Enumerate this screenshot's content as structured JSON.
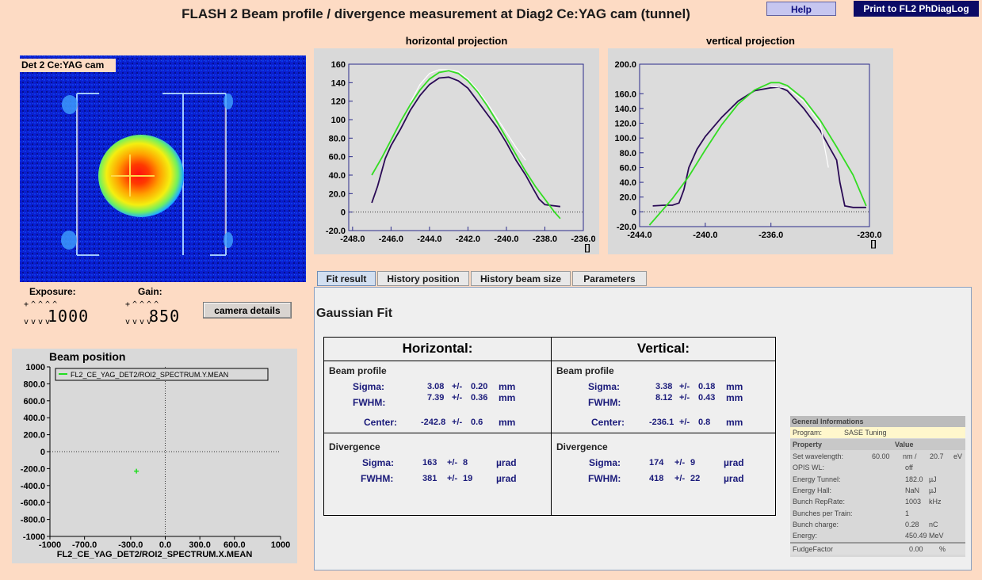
{
  "title": "FLASH 2  Beam profile / divergence measurement at Diag2 Ce:YAG cam (tunnel)",
  "buttons": {
    "help": "Help",
    "print": "Print to FL2  PhDiagLog",
    "camera_details": "camera details"
  },
  "camera": {
    "label": "Det 2 Ce:YAG cam"
  },
  "controls": {
    "exposure_label": "Exposure:",
    "exposure_value": "1000",
    "gain_label": "Gain:",
    "gain_value": "850",
    "spin_up": "+^^^^",
    "spin_down": "vvvv"
  },
  "horizontal_projection": {
    "title": "horizontal projection",
    "chart_data": {
      "type": "line",
      "x_ticks": [
        "-248.0",
        "-246.0",
        "-244.0",
        "-242.0",
        "-240.0",
        "-238.0",
        "-236.0"
      ],
      "y_ticks": [
        "160",
        "140",
        "120",
        "100",
        "80.0",
        "60.0",
        "40.0",
        "20.0",
        "0",
        "-20.0"
      ],
      "xlim": [
        -248.2,
        -236.0
      ],
      "ylim": [
        -20,
        160
      ],
      "unit_label": "[]",
      "series": [
        {
          "color": "#2a0a55",
          "x": [
            -247.0,
            -246.7,
            -246.3,
            -246.0,
            -245.5,
            -245.0,
            -244.5,
            -244.0,
            -243.5,
            -243.0,
            -242.5,
            -242.0,
            -241.5,
            -241.0,
            -240.5,
            -240.0,
            -239.5,
            -239.0,
            -238.6,
            -238.3,
            -238.0,
            -237.6,
            -237.2
          ],
          "y": [
            10,
            28,
            58,
            72,
            90,
            110,
            126,
            138,
            145,
            146,
            142,
            134,
            120,
            106,
            92,
            75,
            56,
            40,
            25,
            14,
            8,
            7,
            6
          ]
        },
        {
          "color": "#ffffff",
          "x": [
            -245.0,
            -244.5,
            -244.0,
            -243.5,
            -243.0,
            -242.5,
            -242.0,
            -241.5,
            -241.0,
            -240.5,
            -240.0,
            -239.5,
            -239.0
          ],
          "y": [
            118,
            138,
            150,
            154,
            154,
            152,
            144,
            132,
            118,
            102,
            86,
            70,
            56
          ]
        },
        {
          "color": "#33dd22",
          "x": [
            -247.0,
            -246.5,
            -246.0,
            -245.5,
            -245.0,
            -244.5,
            -244.0,
            -243.5,
            -243.0,
            -242.5,
            -242.0,
            -241.5,
            -241.0,
            -240.5,
            -240.0,
            -239.5,
            -239.0,
            -238.5,
            -238.0,
            -237.5,
            -237.2
          ],
          "y": [
            40,
            58,
            78,
            98,
            116,
            132,
            144,
            151,
            153,
            150,
            142,
            130,
            115,
            98,
            80,
            62,
            44,
            28,
            14,
            0,
            -7
          ]
        }
      ]
    }
  },
  "vertical_projection": {
    "title": "vertical projection",
    "chart_data": {
      "type": "line",
      "x_ticks": [
        "-244.0",
        "-240.0",
        "-236.0",
        "-230.0"
      ],
      "y_ticks": [
        "200.0",
        "160.0",
        "140.0",
        "120.0",
        "100.0",
        "80.0",
        "60.0",
        "40.0",
        "20.0",
        "0",
        "-20.0"
      ],
      "xlim": [
        -244.0,
        -230.0
      ],
      "ylim": [
        -20,
        200
      ],
      "unit_label": "[]",
      "series": [
        {
          "color": "#2a0a55",
          "x": [
            -243.2,
            -242.5,
            -242.0,
            -241.6,
            -241.3,
            -241.0,
            -240.5,
            -240.0,
            -239.0,
            -238.0,
            -237.0,
            -236.0,
            -235.5,
            -235.0,
            -234.5,
            -234.0,
            -233.0,
            -232.5,
            -232.0,
            -231.8,
            -231.5,
            -231.0,
            -230.2
          ],
          "y": [
            8,
            9,
            9,
            12,
            30,
            60,
            85,
            102,
            128,
            150,
            164,
            168,
            169,
            164,
            152,
            140,
            110,
            90,
            70,
            40,
            8,
            6,
            6
          ]
        },
        {
          "color": "#ffffff",
          "x": [
            -236.0,
            -235.0,
            -234.0,
            -233.0,
            -232.5
          ],
          "y": [
            170,
            168,
            150,
            120,
            60
          ]
        },
        {
          "color": "#33dd22",
          "x": [
            -243.4,
            -242.5,
            -242.0,
            -241.0,
            -240.0,
            -239.0,
            -238.0,
            -237.0,
            -236.0,
            -235.5,
            -235.0,
            -234.0,
            -233.0,
            -232.0,
            -231.0,
            -230.2
          ],
          "y": [
            -18,
            5,
            18,
            48,
            84,
            118,
            146,
            165,
            175,
            175,
            171,
            153,
            124,
            88,
            50,
            8
          ]
        }
      ]
    }
  },
  "tabs": [
    "Fit result",
    "History position",
    "History beam size",
    "Parameters"
  ],
  "fit": {
    "title": "Gaussian Fit",
    "horizontal": {
      "header": "Horizontal:",
      "beam_profile": "Beam profile",
      "sigma_label": "Sigma:",
      "sigma": "3.08",
      "sigma_err": "0.20",
      "fwhm_label": "FWHM:",
      "fwhm": "7.39",
      "fwhm_err": "0.36",
      "center_label": "Center:",
      "center": "-242.8",
      "center_err": "0.6",
      "unit_mm": "mm",
      "divergence": "Divergence",
      "div_sigma": "163",
      "div_sigma_err": "8",
      "div_fwhm": "381",
      "div_fwhm_err": "19",
      "unit_urad": "µrad",
      "pm": "+/-"
    },
    "vertical": {
      "header": "Vertical:",
      "beam_profile": "Beam profile",
      "sigma_label": "Sigma:",
      "sigma": "3.38",
      "sigma_err": "0.18",
      "fwhm_label": "FWHM:",
      "fwhm": "8.12",
      "fwhm_err": "0.43",
      "center_label": "Center:",
      "center": "-236.1",
      "center_err": "0.8",
      "unit_mm": "mm",
      "divergence": "Divergence",
      "div_sigma": "174",
      "div_sigma_err": "9",
      "div_fwhm": "418",
      "div_fwhm_err": "22",
      "unit_urad": "µrad",
      "pm": "+/-"
    }
  },
  "general_info": {
    "header": "General Informations",
    "program_label": "Program:",
    "program_value": "SASE Tuning",
    "col_property": "Property",
    "col_value": "Value",
    "rows": [
      {
        "label": "Set wavelength:",
        "value": "60.00",
        "unit": "nm /",
        "extra": "20.7",
        "extra_unit": "eV"
      },
      {
        "label": "OPIS WL:",
        "value": "off",
        "unit": "",
        "extra": "",
        "extra_unit": ""
      },
      {
        "label": "Energy Tunnel:",
        "value": "182.0",
        "unit": "µJ",
        "extra": "",
        "extra_unit": ""
      },
      {
        "label": "Energy Hall:",
        "value": "NaN",
        "unit": "µJ",
        "extra": "",
        "extra_unit": ""
      },
      {
        "label": "Bunch RepRate:",
        "value": "1003",
        "unit": "kHz",
        "extra": "",
        "extra_unit": ""
      },
      {
        "label": "Bunches per Train:",
        "value": "1",
        "unit": "",
        "extra": "",
        "extra_unit": ""
      },
      {
        "label": "Bunch charge:",
        "value": "0.28",
        "unit": "nC",
        "extra": "",
        "extra_unit": ""
      },
      {
        "label": "Energy:",
        "value": "450.49",
        "unit": "MeV",
        "extra": "",
        "extra_unit": ""
      }
    ],
    "fudge_label": "FudgeFactor",
    "fudge_value": "0.00",
    "fudge_unit": "%"
  },
  "beam_position": {
    "title": "Beam position",
    "chart_data": {
      "type": "scatter",
      "legend": "FL2_CE_YAG_DET2/ROI2_SPECTRUM.Y.MEAN",
      "xlabel": "FL2_CE_YAG_DET2/ROI2_SPECTRUM.X.MEAN",
      "x_ticks": [
        "-1000",
        "-700.0",
        "-300.0",
        "0.0",
        "300.0",
        "600.0",
        "1000"
      ],
      "y_ticks": [
        "1000",
        "800.0",
        "600.0",
        "400.0",
        "200.0",
        "0",
        "-200.0",
        "-400.0",
        "-600.0",
        "-800.0",
        "-1000"
      ],
      "xlim": [
        -1000,
        1000
      ],
      "ylim": [
        -1000,
        1000
      ],
      "points": [
        {
          "x": -250,
          "y": -230
        }
      ],
      "color": "#22dd22"
    }
  }
}
